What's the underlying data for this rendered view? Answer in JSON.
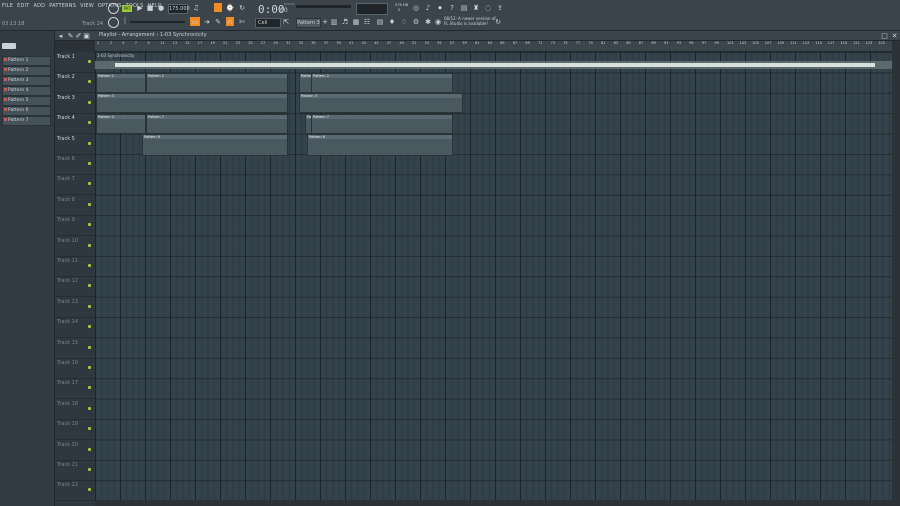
{
  "menu": [
    "FILE",
    "EDIT",
    "ADD",
    "PATTERNS",
    "VIEW",
    "OPTIONS",
    "TOOLS",
    "HELP"
  ],
  "hint": {
    "left": "03:13:18",
    "right": "Track 24"
  },
  "transport": {
    "pat_label": "PAT",
    "tempo": "175.000",
    "time": "0:00",
    "time_unit": "00",
    "time_label": "M:S:CS",
    "cpu": "578 MB",
    "cpu2": "0"
  },
  "toolbar": {
    "snap": "Cell",
    "pattern": "Pattern 3"
  },
  "news": {
    "line1": "08/12: A newer version of",
    "line2": "FL Studio is available!"
  },
  "browser": {
    "patterns": [
      "Pattern 1",
      "Pattern 2",
      "Pattern 3",
      "Pattern 4",
      "Pattern 5",
      "Pattern 6",
      "Pattern 7"
    ]
  },
  "playlist": {
    "breadcrumb": "Playlist - Arrangement › 1-03 Synchronicity",
    "ruler": [
      "2",
      "3",
      "5",
      "7",
      "9",
      "11",
      "13",
      "15",
      "17",
      "19",
      "21",
      "23",
      "25",
      "27",
      "29",
      "31",
      "33",
      "35",
      "37",
      "39",
      "41",
      "43",
      "45",
      "47",
      "49",
      "51",
      "53",
      "55",
      "57",
      "59",
      "61",
      "63",
      "65",
      "67",
      "69",
      "71",
      "73",
      "75",
      "77",
      "79",
      "81",
      "83",
      "85",
      "87",
      "89",
      "91",
      "93",
      "95",
      "97",
      "99",
      "101",
      "103",
      "105",
      "107",
      "109",
      "111",
      "113",
      "115",
      "117",
      "119",
      "121",
      "123",
      "125"
    ],
    "tracks": [
      "Track 1",
      "Track 2",
      "Track 3",
      "Track 4",
      "Track 5",
      "Track 6",
      "Track 7",
      "Track 8",
      "Track 9",
      "Track 10",
      "Track 11",
      "Track 12",
      "Track 13",
      "Track 14",
      "Track 15",
      "Track 16",
      "Track 17",
      "Track 18",
      "Track 19",
      "Track 20",
      "Track 21",
      "Track 22"
    ],
    "audio_clip": "1-03 Synchronicity",
    "clips": {
      "p1": "Pattern 1",
      "p2": "Pattern 2",
      "p3": "Pattern 3",
      "p4": "Pattern 4",
      "p5": "Pattern 5",
      "p6": "Pattern 6",
      "p7": "Pattern 7"
    }
  }
}
